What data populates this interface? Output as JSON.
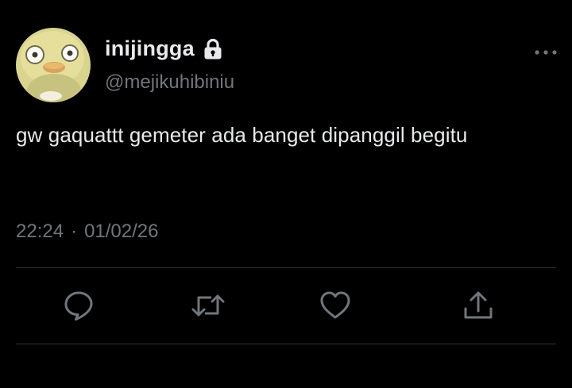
{
  "tweet": {
    "author": {
      "display_name": "inijingga",
      "handle": "@mejikuhibiniu",
      "protected": true
    },
    "text": "gw gaquattt gemeter ada banget dipanggil begitu",
    "time": "22:24",
    "separator": "·",
    "date": "01/02/26"
  },
  "icons": {
    "lock": "lock-icon",
    "more": "more-horizontal-icon",
    "reply": "reply-icon",
    "retweet": "retweet-icon",
    "like": "heart-icon",
    "share": "share-icon"
  },
  "colors": {
    "background": "#000000",
    "primary_text": "#e7e9ea",
    "secondary_text": "#71767b",
    "divider": "#2f3336"
  }
}
